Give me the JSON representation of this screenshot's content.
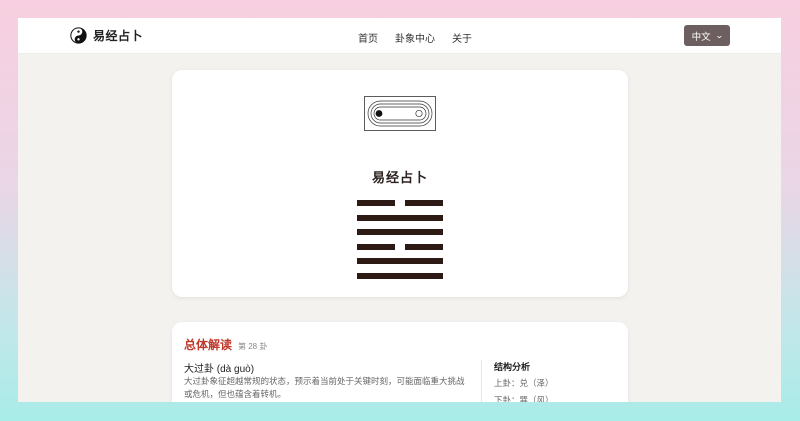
{
  "nav": {
    "brand": "易经占卜",
    "links": [
      "首页",
      "卦象中心",
      "关于"
    ],
    "language": "中文"
  },
  "hero": {
    "title": "易经占卜",
    "hexagram_lines": [
      "broken",
      "solid",
      "solid",
      "broken",
      "solid",
      "solid"
    ]
  },
  "interpretation": {
    "heading": "总体解读",
    "number": "第 28 卦",
    "name": "大过卦 (dà guò)",
    "description": "大过卦象征超越常规的状态，预示着当前处于关键时刻，可能面临重大挑战或危机，但也蕴含着转机。",
    "structure_title": "结构分析",
    "upper": "上卦：兑（泽）",
    "lower": "下卦：巽（风）"
  },
  "colors": {
    "accent": "#c0392b",
    "lang_button": "#6d5f60",
    "line": "#2d1a15"
  }
}
